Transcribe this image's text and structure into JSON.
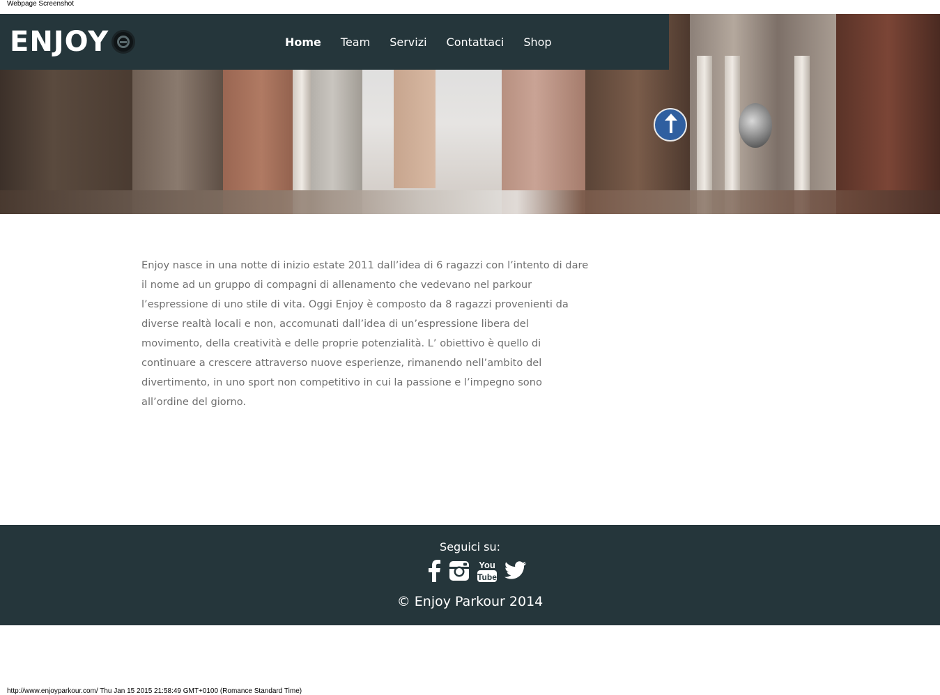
{
  "capture": {
    "label": "Webpage Screenshot",
    "footer_text": "http://www.enjoyparkour.com/ Thu Jan 15 2015 21:58:49 GMT+0100 (Romance Standard Time)"
  },
  "brand": {
    "logo_text": "ENJOY",
    "logo_icon": "enjoy-e-emblem-icon"
  },
  "nav": {
    "items": [
      {
        "label": "Home",
        "active": true
      },
      {
        "label": "Team",
        "active": false
      },
      {
        "label": "Servizi",
        "active": false
      },
      {
        "label": "Contattaci",
        "active": false
      },
      {
        "label": "Shop",
        "active": false
      }
    ]
  },
  "main": {
    "intro": "Enjoy nasce in una notte di inizio estate 2011 dall’idea di 6 ragazzi con l’intento di dare il nome ad un gruppo di compagni di allenamento che vedevano nel parkour l’espressione di uno stile di vita. Oggi Enjoy è composto da 8 ragazzi provenienti da diverse realtà locali e non, accomunati dall’idea di un’espressione libera del movimento, della creatività e delle proprie potenzialità. L’ obiettivo è quello di continuare a crescere attraverso nuove esperienze, rimanendo nell’ambito del divertimento, in uno sport non competitivo in cui la passione e l’impegno sono all’ordine del giorno."
  },
  "footer": {
    "follow_label": "Seguici su:",
    "socials": [
      "facebook-icon",
      "instagram-icon",
      "youtube-icon",
      "twitter-icon"
    ],
    "youtube_text": [
      "You",
      "Tube"
    ],
    "copyright": "© Enjoy Parkour 2014"
  },
  "colors": {
    "header_bg": "#25363b",
    "footer_bg": "#25363b",
    "body_text": "#6f6f6f",
    "nav_text": "#ffffff"
  }
}
